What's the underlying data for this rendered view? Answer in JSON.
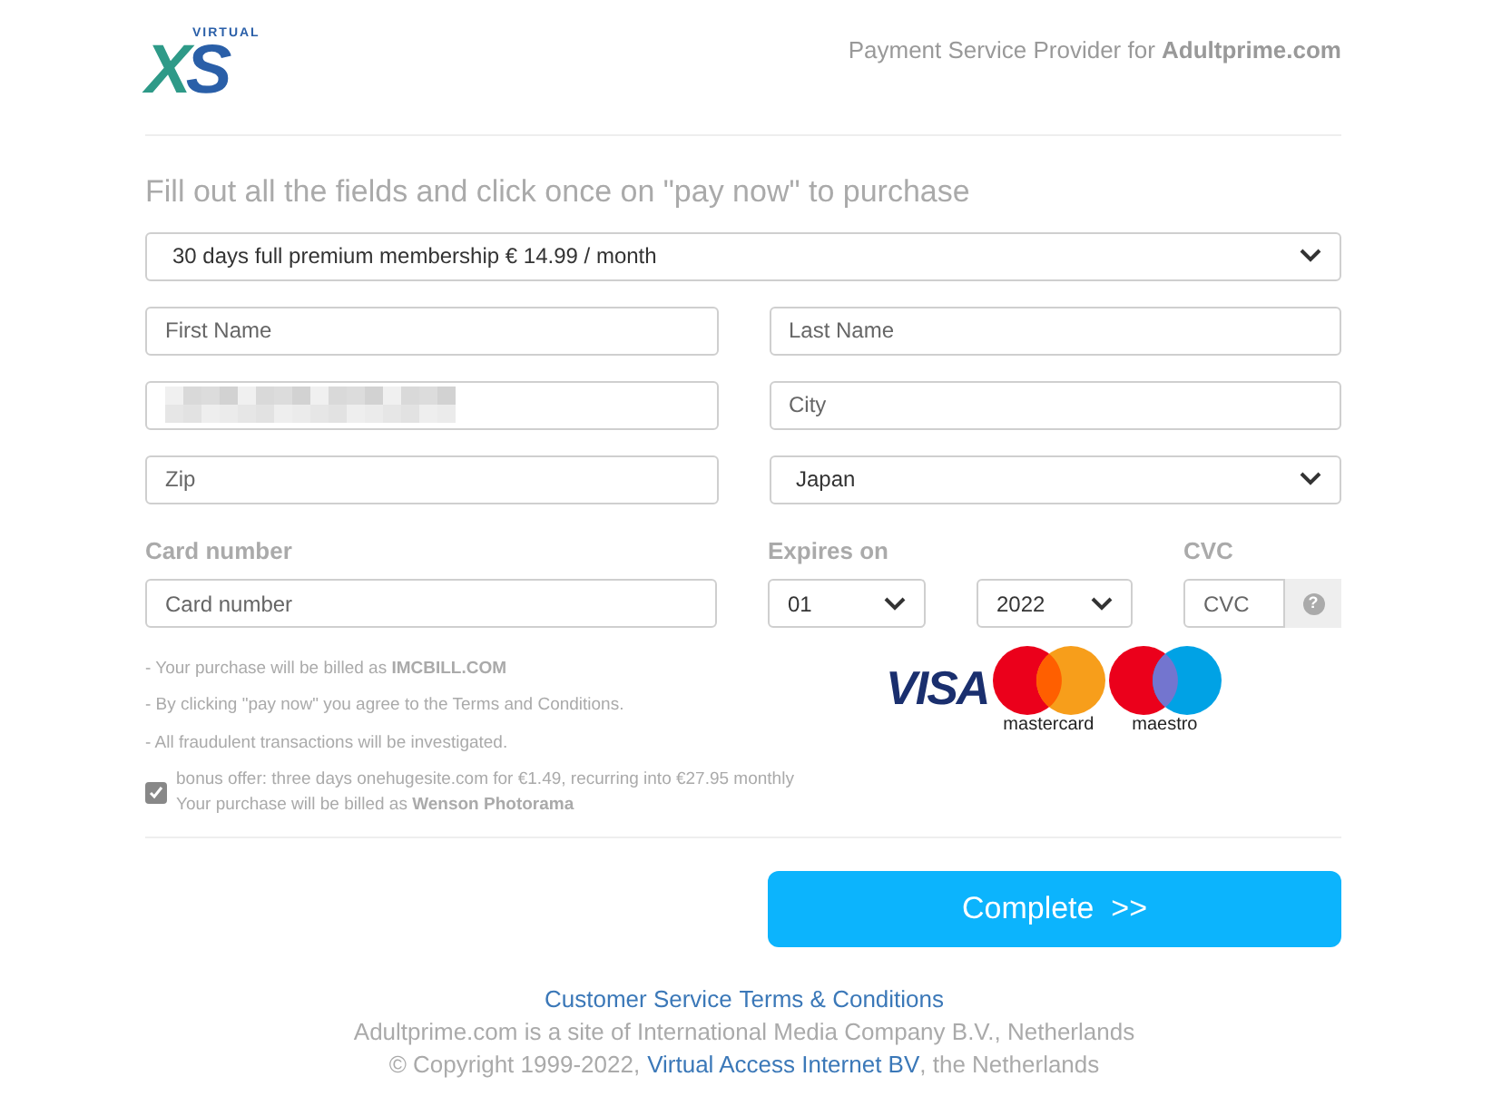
{
  "header": {
    "logo": {
      "small": "VIRTUAL",
      "big": "XS"
    },
    "tagline": "Payment Service Provider for **Adultprime.com**"
  },
  "heading": "Fill out all the fields and click once on \"pay now\" to purchase",
  "plan_select": {
    "value": "30 days full premium membership € 14.99 / month"
  },
  "fields": [
    {
      "kind": "input",
      "placeholder": "First Name"
    },
    {
      "kind": "input",
      "placeholder": "Last Name"
    },
    {
      "kind": "redacted"
    },
    {
      "kind": "input",
      "placeholder": "City"
    },
    {
      "kind": "input",
      "placeholder": "Zip"
    },
    {
      "kind": "select",
      "value": "Japan"
    }
  ],
  "card": {
    "label": "Card number",
    "placeholder": "Card number"
  },
  "expires": {
    "label": "Expires on",
    "month": "01",
    "year": "2022"
  },
  "cvc": {
    "label": "CVC",
    "placeholder": "CVC",
    "help": "?"
  },
  "notes": [
    "- Your purchase will be billed as **IMCBILL.COM**",
    "- By clicking \"pay now\" you agree to the Terms and Conditions.",
    "- All fraudulent transactions will be investigated."
  ],
  "bonus": {
    "checked": true,
    "lines": [
      "bonus offer: three days onehugesite.com for €1.49, recurring into €27.95 monthly",
      "Your purchase will be billed as **Wenson Photorama**"
    ]
  },
  "card_logos": [
    {
      "kind": "visa",
      "label": "VISA"
    },
    {
      "kind": "mastercard",
      "label": "mastercard"
    },
    {
      "kind": "maestro",
      "label": "maestro"
    }
  ],
  "submit": {
    "label": "Complete  >>"
  },
  "footer": {
    "links": [
      "Customer Service",
      "Terms & Conditions"
    ],
    "company": "Adultprime.com is a site of International Media Company B.V., Netherlands",
    "copyright": {
      "before": "© Copyright 1999-2022,",
      "link": "Virtual Access Internet BV",
      "after": ", the Netherlands"
    }
  }
}
